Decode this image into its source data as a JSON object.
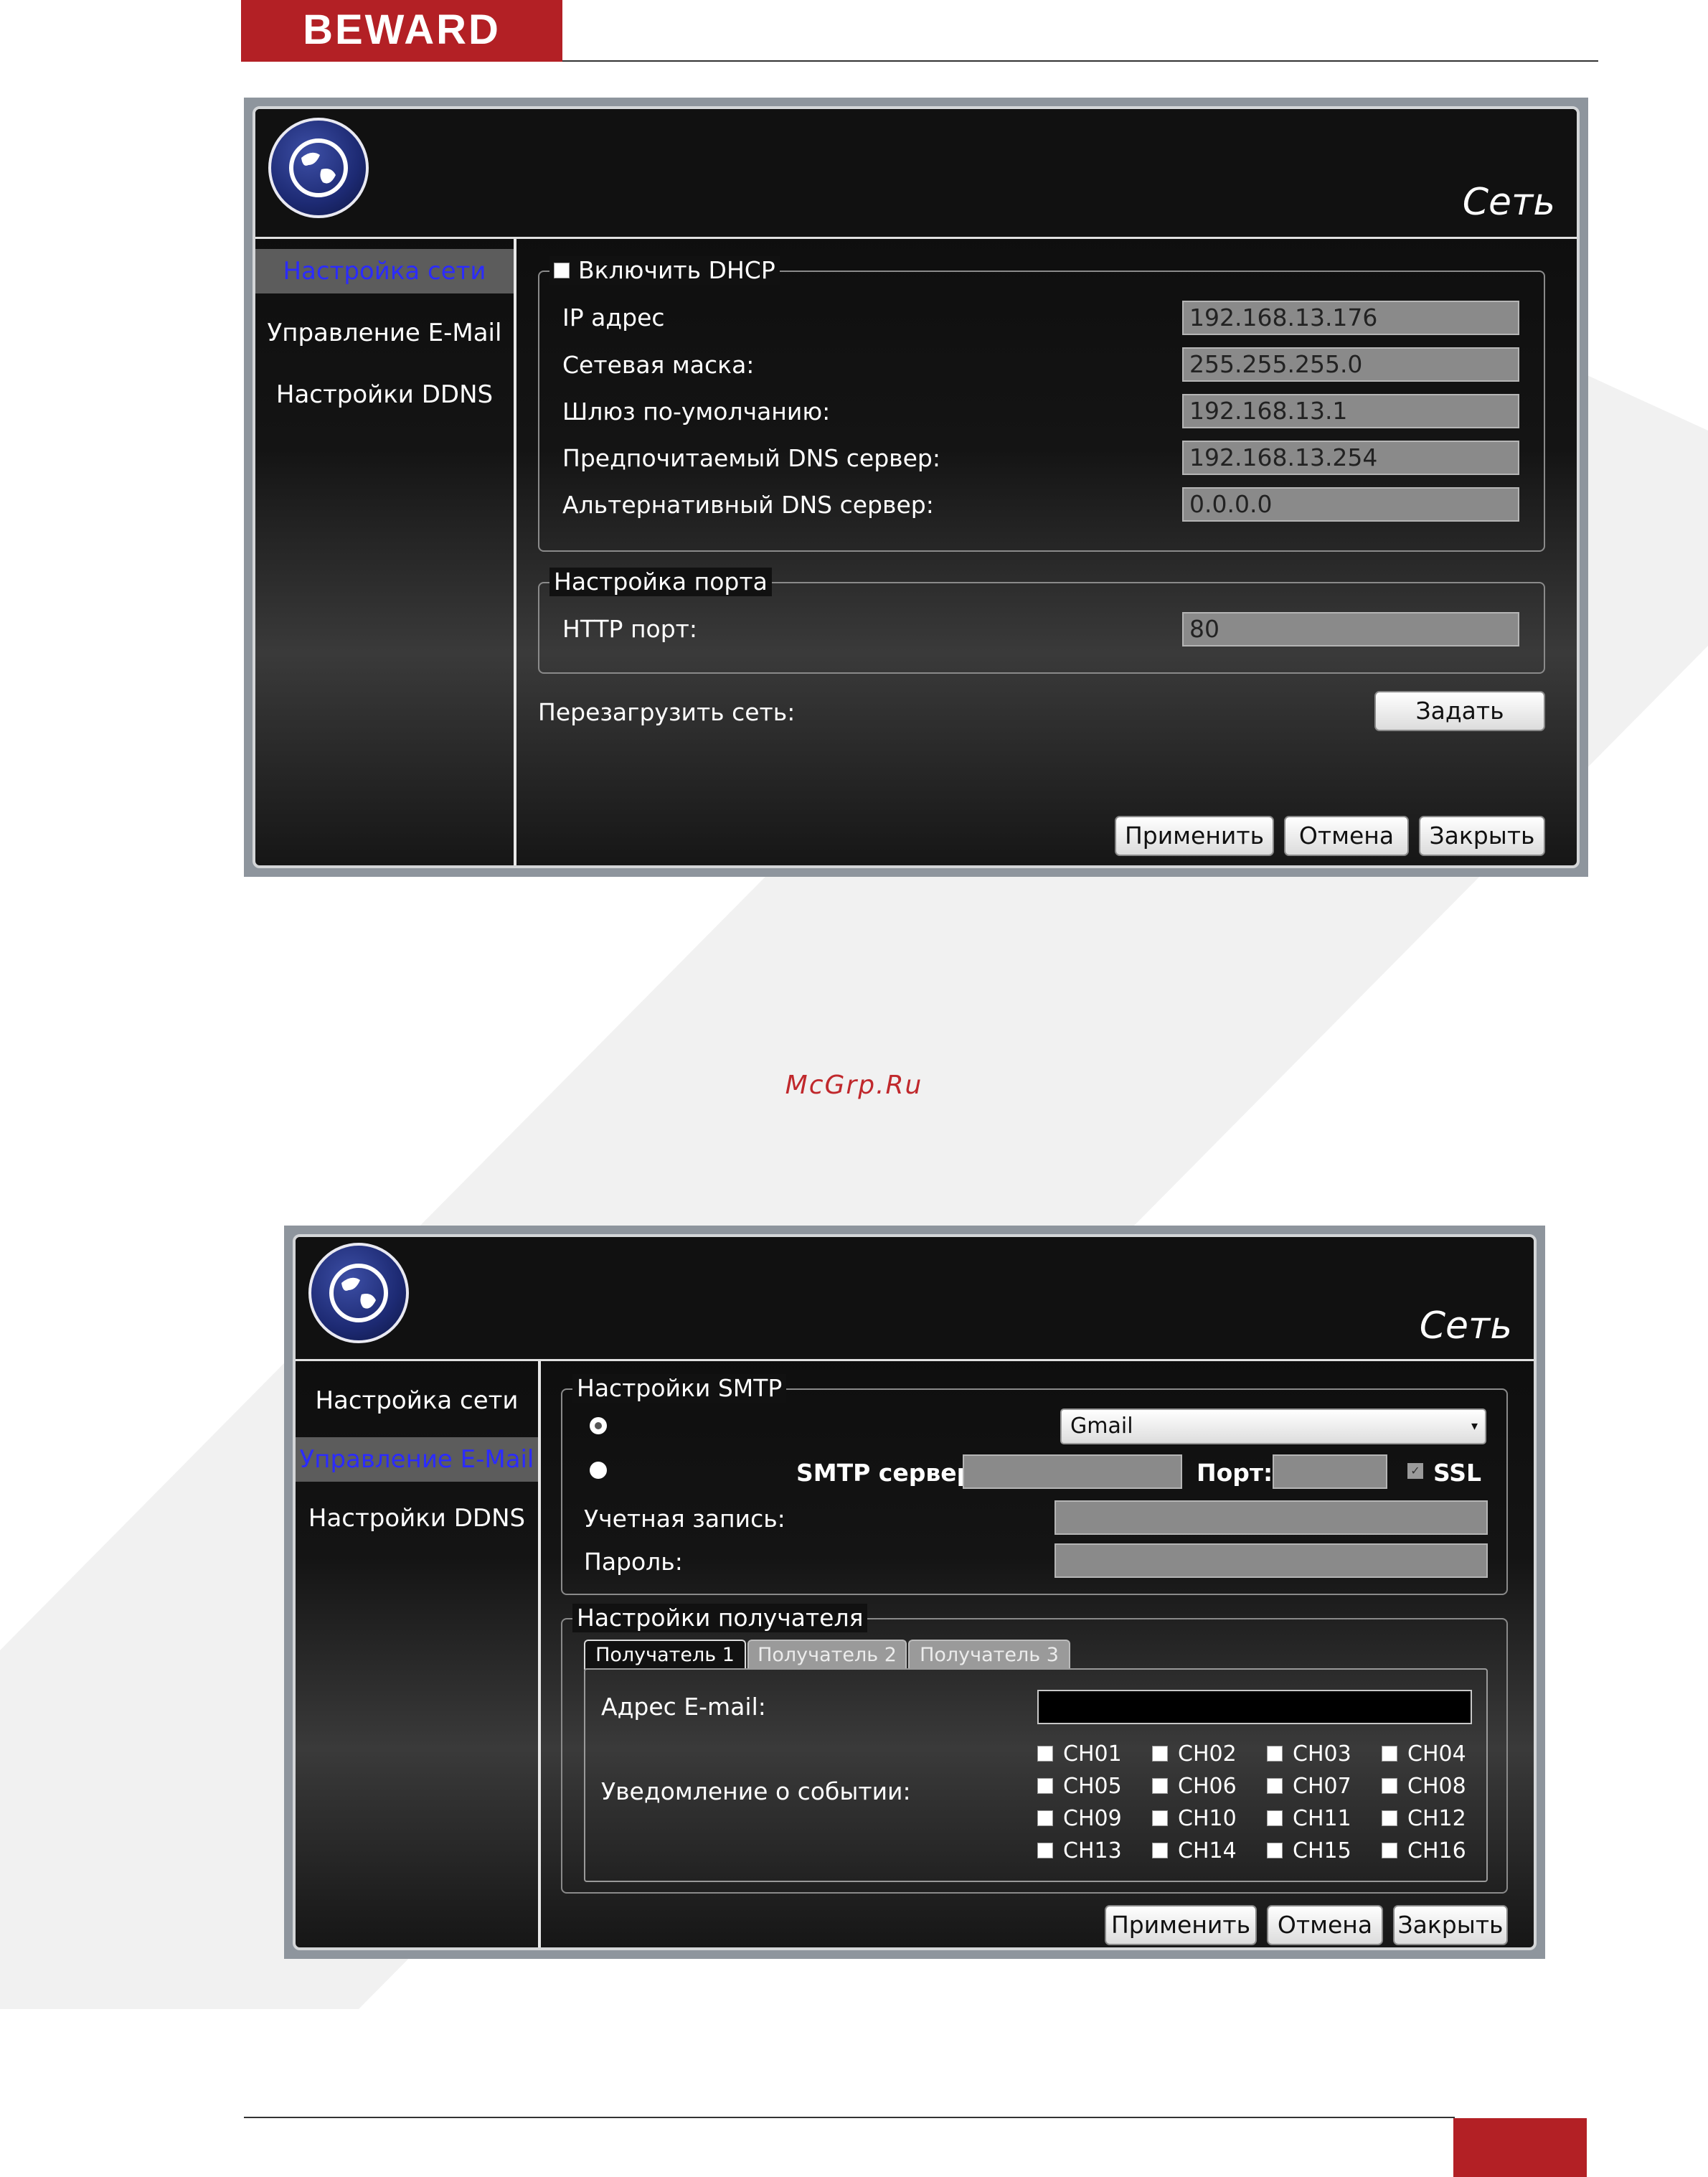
{
  "brand": {
    "logo_text": "BEWARD",
    "watermark_text": "McGrp.Ru"
  },
  "dialog1": {
    "title": "Сеть",
    "sidebar": [
      {
        "label": "Настройка сети",
        "active": true
      },
      {
        "label": "Управление E-Mail",
        "active": false
      },
      {
        "label": "Настройки DDNS",
        "active": false
      }
    ],
    "dhcp_label": "Включить DHCP",
    "dhcp_checked": false,
    "fields": [
      {
        "label": "IP адрес",
        "value": "192.168.13.176"
      },
      {
        "label": "Сетевая маска:",
        "value": "255.255.255.0"
      },
      {
        "label": "Шлюз по-умолчанию:",
        "value": "192.168.13.1"
      },
      {
        "label": "Предпочитаемый DNS сервер:",
        "value": "192.168.13.254"
      },
      {
        "label": "Альтернативный DNS сервер:",
        "value": "0.0.0.0"
      }
    ],
    "port_legend": "Настройка порта",
    "http_port_label": "HTTP порт:",
    "http_port_value": "80",
    "restart_label": "Перезагрузить сеть:",
    "set_button": "Задать",
    "apply_button": "Применить",
    "cancel_button": "Отмена",
    "close_button": "Закрыть"
  },
  "dialog2": {
    "title": "Сеть",
    "sidebar": [
      {
        "label": "Настройка сети",
        "active": false
      },
      {
        "label": "Управление E-Mail",
        "active": true
      },
      {
        "label": "Настройки DDNS",
        "active": false
      }
    ],
    "smtp_legend": "Настройки SMTP",
    "provider_selected": "Gmail",
    "smtp_server_label": "SMTP сервер:",
    "smtp_server_value": "",
    "port_label": "Порт:",
    "port_value": "",
    "ssl_label": "SSL",
    "ssl_checked": true,
    "account_label": "Учетная запись:",
    "account_value": "",
    "password_label": "Пароль:",
    "password_value": "",
    "recipient_legend": "Настройки получателя",
    "tabs": [
      {
        "label": "Получатель 1",
        "active": true
      },
      {
        "label": "Получатель 2",
        "active": false
      },
      {
        "label": "Получатель 3",
        "active": false
      }
    ],
    "email_label": "Адрес E-mail:",
    "email_value": "",
    "event_label": "Уведомление о событии:",
    "channels": [
      "CH01",
      "CH02",
      "CH03",
      "CH04",
      "CH05",
      "CH06",
      "CH07",
      "CH08",
      "CH09",
      "CH10",
      "CH11",
      "CH12",
      "CH13",
      "CH14",
      "CH15",
      "CH16"
    ],
    "apply_button": "Применить",
    "cancel_button": "Отмена",
    "close_button": "Закрыть"
  }
}
